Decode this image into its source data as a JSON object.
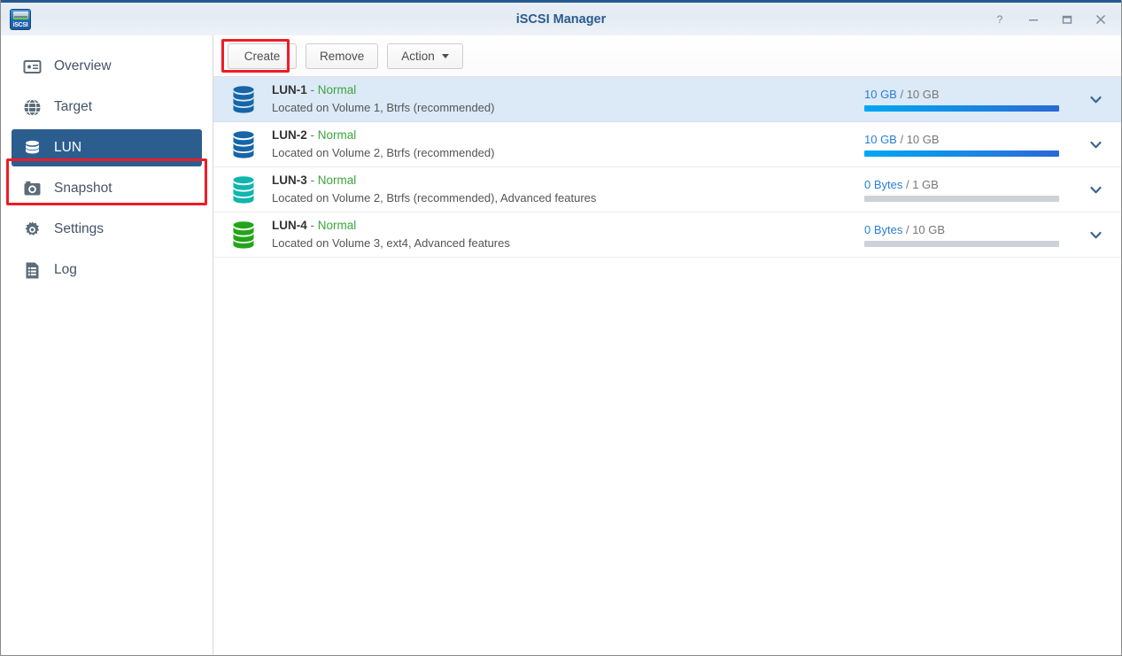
{
  "window": {
    "title": "iSCSI Manager",
    "app_icon": "iscsi-app-icon",
    "app_icon_label": "iSCSI",
    "controls": [
      {
        "name": "help-button",
        "glyph": "?"
      },
      {
        "name": "minimize-button",
        "glyph": "—"
      },
      {
        "name": "maximize-button",
        "glyph": "□"
      },
      {
        "name": "close-button",
        "glyph": "×"
      }
    ]
  },
  "sidebar": {
    "items": [
      {
        "label": "Overview",
        "icon": "overview-card-icon",
        "active": false
      },
      {
        "label": "Target",
        "icon": "globe-icon",
        "active": false
      },
      {
        "label": "LUN",
        "icon": "database-icon",
        "active": true
      },
      {
        "label": "Snapshot",
        "icon": "camera-icon",
        "active": false
      },
      {
        "label": "Settings",
        "icon": "gear-icon",
        "active": false
      },
      {
        "label": "Log",
        "icon": "list-document-icon",
        "active": false
      }
    ]
  },
  "toolbar": {
    "create_label": "Create",
    "remove_label": "Remove",
    "action_label": "Action"
  },
  "lun_list": [
    {
      "name": "LUN-1",
      "separator": "-",
      "status": "Normal",
      "location": "Located on Volume 1, Btrfs (recommended)",
      "used": "10 GB",
      "total": "10 GB",
      "capacity_text_rest": "/ 10 GB",
      "percent": 100,
      "icon_color": "#1565a8",
      "selected": true
    },
    {
      "name": "LUN-2",
      "separator": "-",
      "status": "Normal",
      "location": "Located on Volume 2, Btrfs (recommended)",
      "used": "10 GB",
      "total": "10 GB",
      "capacity_text_rest": "/ 10 GB",
      "percent": 100,
      "icon_color": "#1565a8",
      "selected": false
    },
    {
      "name": "LUN-3",
      "separator": "-",
      "status": "Normal",
      "location": "Located on Volume 2, Btrfs (recommended), Advanced features",
      "used": "0 Bytes",
      "total": "1 GB",
      "capacity_text_rest": "/ 1 GB",
      "percent": 0,
      "icon_color": "#10b5ae",
      "selected": false
    },
    {
      "name": "LUN-4",
      "separator": "-",
      "status": "Normal",
      "location": "Located on Volume 3, ext4, Advanced features",
      "used": "0 Bytes",
      "total": "10 GB",
      "capacity_text_rest": "/ 10 GB",
      "percent": 0,
      "icon_color": "#22a517",
      "selected": false
    }
  ],
  "annotations": {
    "highlight_color": "#ee1c25",
    "targets": [
      "create-button",
      "sidebar-item-lun"
    ]
  },
  "colors": {
    "title_text": "#2a5c8d",
    "sidebar_active_bg": "#2c5d8f",
    "row_selected_bg": "#dce9f7",
    "status_ok": "#3ba63b",
    "capacity_used": "#2a7fd4"
  }
}
